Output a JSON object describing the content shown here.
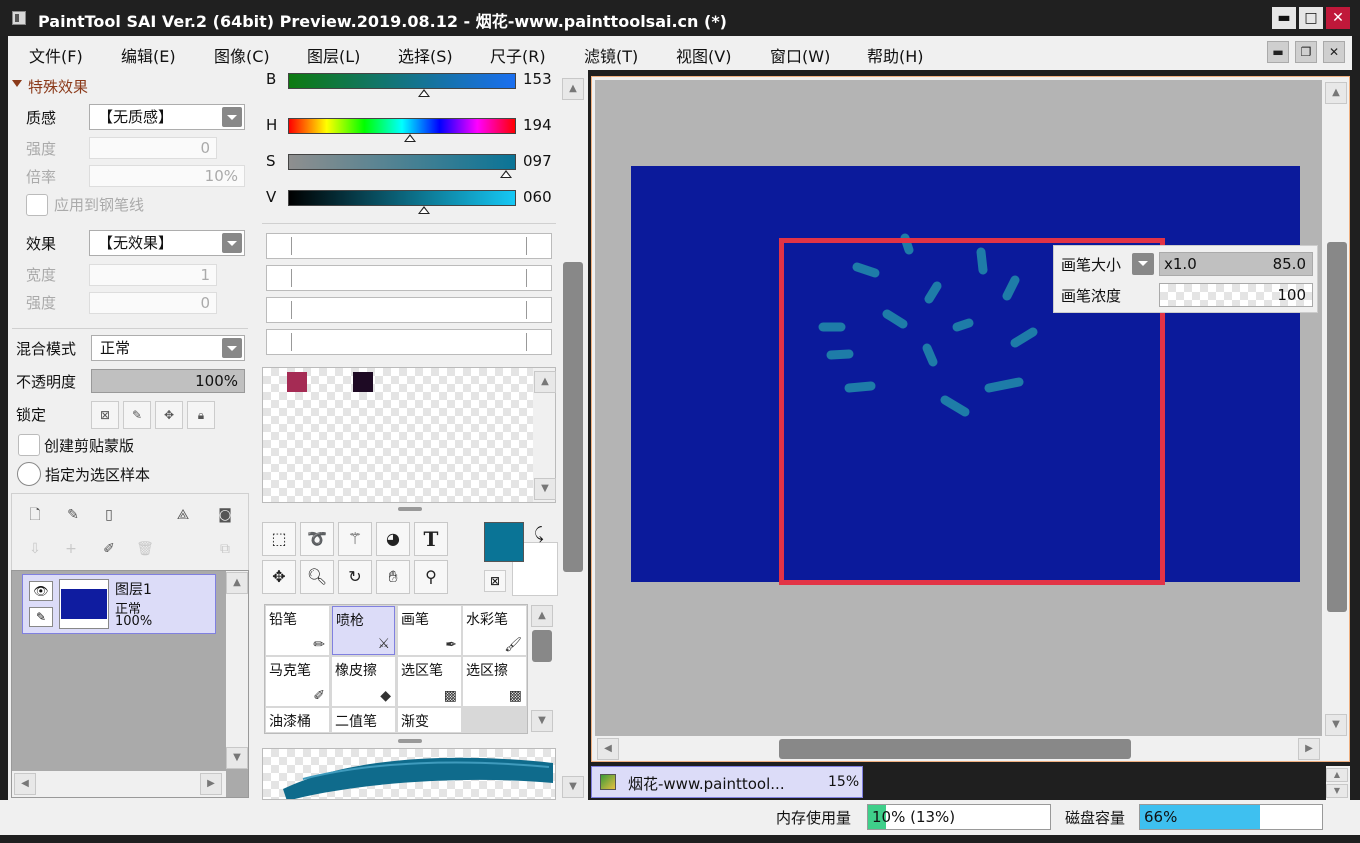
{
  "window": {
    "title": "PaintTool SAI Ver.2 (64bit) Preview.2019.08.12 - 烟花-www.painttoolsai.cn (*)",
    "minimize": "▬",
    "maximize": "□",
    "close": "✕"
  },
  "menu": [
    "文件(F)",
    "编辑(E)",
    "图像(C)",
    "图层(L)",
    "选择(S)",
    "尺子(R)",
    "滤镜(T)",
    "视图(V)",
    "窗口(W)",
    "帮助(H)"
  ],
  "left": {
    "section_title": "特殊效果",
    "texture_label": "质感",
    "texture_value": "【无质感】",
    "strength_label": "强度",
    "strength_value": "0",
    "rate_label": "倍率",
    "rate_value": "10%",
    "apply_pen_label": "应用到钢笔线",
    "effect_label": "效果",
    "effect_value": "【无效果】",
    "width_label": "宽度",
    "width_value": "1",
    "strength2_label": "强度",
    "strength2_value": "0",
    "blend_label": "混合模式",
    "blend_value": "正常",
    "opacity_label": "不透明度",
    "opacity_value": "100%",
    "lock_label": "锁定",
    "clip_label": "创建剪贴蒙版",
    "sample_label": "指定为选区样本",
    "layer": {
      "name": "图层1",
      "mode": "正常",
      "opacity": "100%"
    }
  },
  "color": {
    "b_label": "B",
    "b_value": "153",
    "h_label": "H",
    "h_value": "194",
    "s_label": "S",
    "s_value": "097",
    "v_label": "V",
    "v_value": "060",
    "main_color": "#0a7496",
    "swatches": [
      "#a52b54",
      "#1e0a24"
    ]
  },
  "tools": {
    "text_tool": "T"
  },
  "brushes": {
    "row1": [
      "铅笔",
      "喷枪",
      "画笔",
      "水彩笔"
    ],
    "row2": [
      "马克笔",
      "橡皮擦",
      "选区笔",
      "选区擦"
    ],
    "row3": [
      "油漆桶",
      "二值笔",
      "渐变"
    ]
  },
  "canvas": {
    "doc_color": "#0b1a9b",
    "stroke_color": "#1e7ca8",
    "highlight_color": "#e23346"
  },
  "brush_info": {
    "size_label": "画笔大小",
    "size_mult": "x1.0",
    "size_value": "85.0",
    "density_label": "画笔浓度",
    "density_value": "100"
  },
  "doc_tab": {
    "name": "烟花-www.painttool...",
    "zoom": "15%"
  },
  "status": {
    "memory_label": "内存使用量",
    "memory_value": "10% (13%)",
    "memory_fraction": 0.1,
    "disk_label": "磁盘容量",
    "disk_value": "66%",
    "disk_fraction": 0.66
  }
}
